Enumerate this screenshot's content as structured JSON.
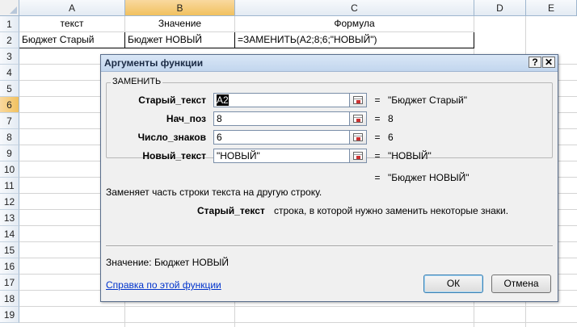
{
  "columns": {
    "A": "A",
    "B": "B",
    "C": "C",
    "D": "D",
    "E": "E"
  },
  "rows": [
    "1",
    "2",
    "3",
    "4",
    "5",
    "6",
    "7",
    "8",
    "9",
    "10",
    "11",
    "12",
    "13",
    "14",
    "15",
    "16",
    "17",
    "18",
    "19"
  ],
  "cells": {
    "A1": "текст",
    "B1": "Значение",
    "C1": "Формула",
    "A2": "Бюджет Старый",
    "B2": "Бюджет НОВЫЙ",
    "C2": "=ЗАМЕНИТЬ(A2;8;6;\"НОВЫЙ\")"
  },
  "dialog": {
    "title": "Аргументы функции",
    "help_btn": "?",
    "close_btn": "✕",
    "function_name": "ЗАМЕНИТЬ",
    "args": [
      {
        "label": "Старый_текст",
        "input_sel": "A2",
        "input": "",
        "equals": "=",
        "value": "\"Бюджет Старый\""
      },
      {
        "label": "Нач_поз",
        "input_sel": "",
        "input": "8",
        "equals": "=",
        "value": "8"
      },
      {
        "label": "Число_знаков",
        "input_sel": "",
        "input": "6",
        "equals": "=",
        "value": "6"
      },
      {
        "label": "Новый_текст",
        "input_sel": "",
        "input": "\"НОВЫЙ\"",
        "equals": "=",
        "value": "\"НОВЫЙ\""
      }
    ],
    "result_equals": "=",
    "result_value": "\"Бюджет НОВЫЙ\"",
    "description": "Заменяет часть строки текста на другую строку.",
    "arg_help_name": "Старый_текст",
    "arg_help_text": "строка, в которой нужно заменить некоторые знаки.",
    "value_label": "Значение:",
    "value_result": "Бюджет НОВЫЙ",
    "help_link": "Справка по этой функции",
    "ok": "ОК",
    "cancel": "Отмена"
  },
  "colors": {
    "selected_header": "#f1c15f",
    "header_border": "#9eb6ce",
    "link": "#0033cc"
  }
}
